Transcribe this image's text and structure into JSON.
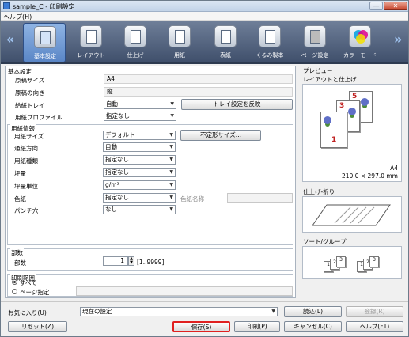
{
  "window": {
    "title": "sample_C - 印刷設定",
    "minimize": "—",
    "close": "✕"
  },
  "menu": {
    "help": "ヘルプ(H)"
  },
  "tabs": [
    {
      "label": "基本設定"
    },
    {
      "label": "レイアウト"
    },
    {
      "label": "仕上げ"
    },
    {
      "label": "用紙"
    },
    {
      "label": "表紙"
    },
    {
      "label": "くるみ製本"
    },
    {
      "label": "ページ設定"
    },
    {
      "label": "カラーモード"
    }
  ],
  "nav": {
    "left": "«",
    "right": "»"
  },
  "basic": {
    "title": "基本設定",
    "original_size_label": "原稿サイズ",
    "original_size_value": "A4",
    "orientation_label": "原稿の向き",
    "orientation_value": "縦",
    "paper_tray_label": "給紙トレイ",
    "paper_tray_value": "自動",
    "tray_button": "トレイ設定を反映",
    "paper_profile_label": "用紙プロファイル",
    "paper_profile_value": "指定なし"
  },
  "paper": {
    "title": "用紙情報",
    "size_label": "用紙サイズ",
    "size_value": "デフォルト",
    "custom_button": "不定形サイズ...",
    "feed_label": "通紙方向",
    "feed_value": "自動",
    "type_label": "用紙種類",
    "type_value": "指定なし",
    "weight_label": "坪量",
    "weight_value": "指定なし",
    "weight_unit_label": "坪量単位",
    "weight_unit_value": "g/m²",
    "color_label": "色紙",
    "color_value": "指定なし",
    "color_name_label": "色紙名称",
    "color_name_value": "",
    "punch_label": "パンチ穴",
    "punch_value": "なし"
  },
  "copies": {
    "title": "部数",
    "label": "部数",
    "value": "1",
    "range": "[1..9999]"
  },
  "range": {
    "title": "印刷範囲",
    "all": "すべて",
    "pages": "ページ指定",
    "pages_value": ""
  },
  "preview": {
    "title": "プレビュー",
    "layout_title": "レイアウトと仕上げ",
    "page_numbers": [
      "5",
      "3",
      "1"
    ],
    "size_text": "A4",
    "size_mm": "210.0 × 297.0 mm",
    "finish_title": "仕上げ-折り",
    "sort_title": "ソート/グループ",
    "sort_numbers": [
      "1",
      "2",
      "3",
      "1",
      "2",
      "3"
    ]
  },
  "footer": {
    "favorites_label": "お気に入り(U)",
    "favorites_value": "現在の設定",
    "load": "読込(L)",
    "register": "登録(R)",
    "reset": "リセット(Z)",
    "save": "保存(S)",
    "print": "印刷(P)",
    "cancel": "キャンセル(C)",
    "help": "ヘルプ(F1)"
  },
  "colors": {
    "accent": "#5a86c6",
    "highlight": "#e02020",
    "titlebar": "#c2d3e8"
  }
}
